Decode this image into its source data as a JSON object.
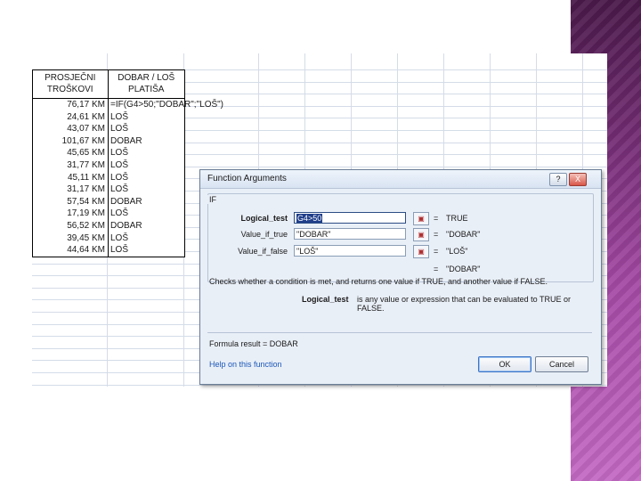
{
  "sheet": {
    "headers": {
      "col1_line1": "PROSJEČNI",
      "col1_line2": "TROŠKOVI",
      "col2_line1": "DOBAR / LOŠ",
      "col2_line2": "PLATIŠA"
    },
    "rows": [
      {
        "cost": "76,17 KM",
        "status": "=IF(G4>50;\"DOBAR\";\"LOŠ\")"
      },
      {
        "cost": "24,61 KM",
        "status": "LOŠ"
      },
      {
        "cost": "43,07 KM",
        "status": "LOŠ"
      },
      {
        "cost": "101,67 KM",
        "status": "DOBAR"
      },
      {
        "cost": "45,65 KM",
        "status": "LOŠ"
      },
      {
        "cost": "31,77 KM",
        "status": "LOŠ"
      },
      {
        "cost": "45,11 KM",
        "status": "LOŠ"
      },
      {
        "cost": "31,17 KM",
        "status": "LOŠ"
      },
      {
        "cost": "57,54 KM",
        "status": "DOBAR"
      },
      {
        "cost": "17,19 KM",
        "status": "LOŠ"
      },
      {
        "cost": "56,52 KM",
        "status": "DOBAR"
      },
      {
        "cost": "39,45 KM",
        "status": "LOŠ"
      },
      {
        "cost": "44,64 KM",
        "status": "LOŠ"
      }
    ]
  },
  "dialog": {
    "title": "Function Arguments",
    "help_glyph": "?",
    "close_glyph": "X",
    "function_name": "IF",
    "args": [
      {
        "label": "Logical_test",
        "value": "G4>50",
        "result": "TRUE",
        "bold": true
      },
      {
        "label": "Value_if_true",
        "value": "\"DOBAR\"",
        "result": "\"DOBAR\""
      },
      {
        "label": "Value_if_false",
        "value": "\"LOŠ\"",
        "result": "\"LOŠ\""
      }
    ],
    "equals": "=",
    "overall_result": "\"DOBAR\"",
    "description": "Checks whether a condition is met, and returns one value if TRUE, and another value if FALSE.",
    "arg_desc_name": "Logical_test",
    "arg_desc_text": "is any value or expression that can be evaluated to TRUE or FALSE.",
    "formula_result": "Formula result =  DOBAR",
    "help_link": "Help on this function",
    "ok_label": "OK",
    "cancel_label": "Cancel"
  },
  "colors": {
    "band": "#6e2a6e",
    "gridline": "#d4dce8",
    "dialog_bg": "#e9eff7",
    "link": "#1b57b8"
  }
}
